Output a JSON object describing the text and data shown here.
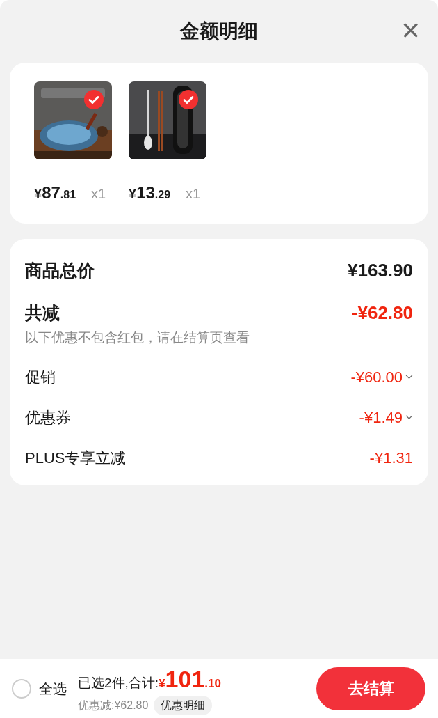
{
  "header": {
    "title": "金额明细",
    "close": "×"
  },
  "products": [
    {
      "checked": true,
      "currency": "¥",
      "yuan": "87",
      "cents": ".81",
      "quantity": "x1",
      "kind": "pan"
    },
    {
      "checked": true,
      "currency": "¥",
      "yuan": "13",
      "cents": ".29",
      "quantity": "x1",
      "kind": "cutlery"
    }
  ],
  "summary": {
    "total_label": "商品总价",
    "total_value": "¥163.90",
    "discount_label": "共减",
    "discount_value": "-¥62.80",
    "note": "以下优惠不包含红包，请在结算页查看",
    "items": [
      {
        "label": "促销",
        "value": "-¥60.00",
        "expandable": true
      },
      {
        "label": "优惠券",
        "value": "-¥1.49",
        "expandable": true
      },
      {
        "label": "PLUS专享立减",
        "value": "-¥1.31",
        "expandable": false
      }
    ]
  },
  "footer": {
    "select_all": {
      "label": "全选",
      "checked": false
    },
    "selected_text": "已选2件,合计:",
    "currency": "¥",
    "yuan": "101",
    "cents": ".10",
    "saved": "优惠减:¥62.80",
    "detail_button": "优惠明细",
    "checkout": "去结算"
  }
}
